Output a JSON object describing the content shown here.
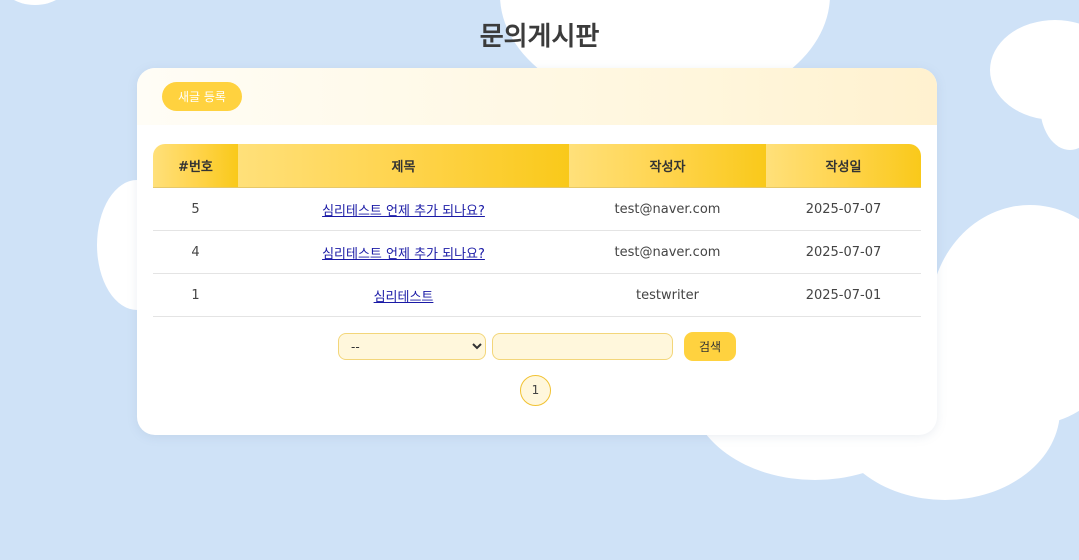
{
  "page": {
    "title": "문의게시판"
  },
  "toolbar": {
    "new_post_label": "새글 등록"
  },
  "table": {
    "headers": {
      "number": "#번호",
      "title": "제목",
      "author": "작성자",
      "date": "작성일"
    },
    "rows": [
      {
        "number": "5",
        "title": "심리테스트 언제 추가 되나요?",
        "author": "test@naver.com",
        "date": "2025-07-07"
      },
      {
        "number": "4",
        "title": "심리테스트 언제 추가 되나요?",
        "author": "test@naver.com",
        "date": "2025-07-07"
      },
      {
        "number": "1",
        "title": "심리테스트",
        "author": "testwriter",
        "date": "2025-07-01"
      }
    ]
  },
  "search": {
    "select_value": "--",
    "input_value": "",
    "button_label": "검색"
  },
  "pagination": {
    "current_page": "1"
  },
  "colors": {
    "background": "#cfe2f7",
    "accent": "#ffd23f",
    "header_gradient_start": "#ffe07a",
    "header_gradient_end": "#f9c91a",
    "link": "#1a1aa6"
  }
}
